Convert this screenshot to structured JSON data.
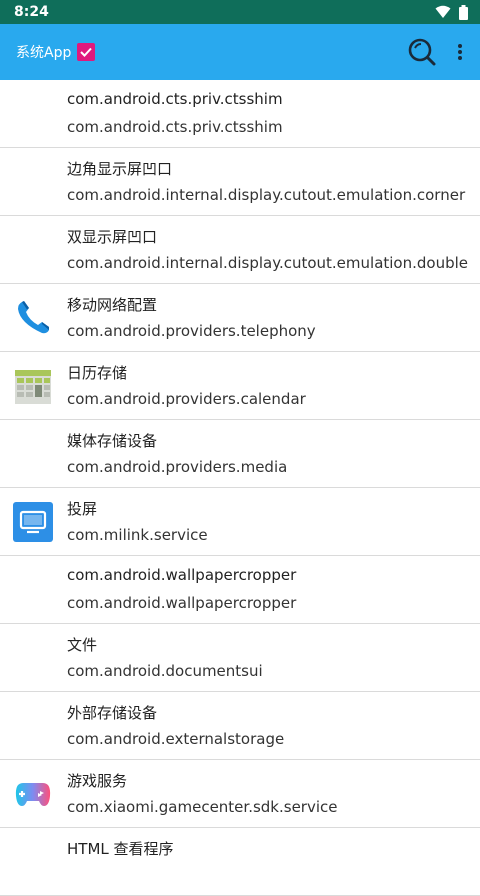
{
  "status_bar": {
    "time": "8:24"
  },
  "app_bar": {
    "title": "系统App",
    "checkbox_checked": true
  },
  "apps": [
    {
      "title": "com.android.cts.priv.ctsshim",
      "package": "com.android.cts.priv.ctsshim",
      "icon": ""
    },
    {
      "title": "边角显示屏凹口",
      "package": "com.android.internal.display.cutout.emulation.corner",
      "icon": ""
    },
    {
      "title": "双显示屏凹口",
      "package": "com.android.internal.display.cutout.emulation.double",
      "icon": ""
    },
    {
      "title": "移动网络配置",
      "package": "com.android.providers.telephony",
      "icon": "phone-icon"
    },
    {
      "title": "日历存储",
      "package": "com.android.providers.calendar",
      "icon": "calendar-icon"
    },
    {
      "title": "媒体存储设备",
      "package": "com.android.providers.media",
      "icon": ""
    },
    {
      "title": "投屏",
      "package": "com.milink.service",
      "icon": "cast-screen-icon"
    },
    {
      "title": "com.android.wallpapercropper",
      "package": "com.android.wallpapercropper",
      "icon": ""
    },
    {
      "title": "文件",
      "package": "com.android.documentsui",
      "icon": ""
    },
    {
      "title": "外部存储设备",
      "package": "com.android.externalstorage",
      "icon": ""
    },
    {
      "title": "游戏服务",
      "package": "com.xiaomi.gamecenter.sdk.service",
      "icon": "gamepad-icon"
    },
    {
      "title": "HTML 查看程序",
      "package": "",
      "icon": ""
    }
  ]
}
